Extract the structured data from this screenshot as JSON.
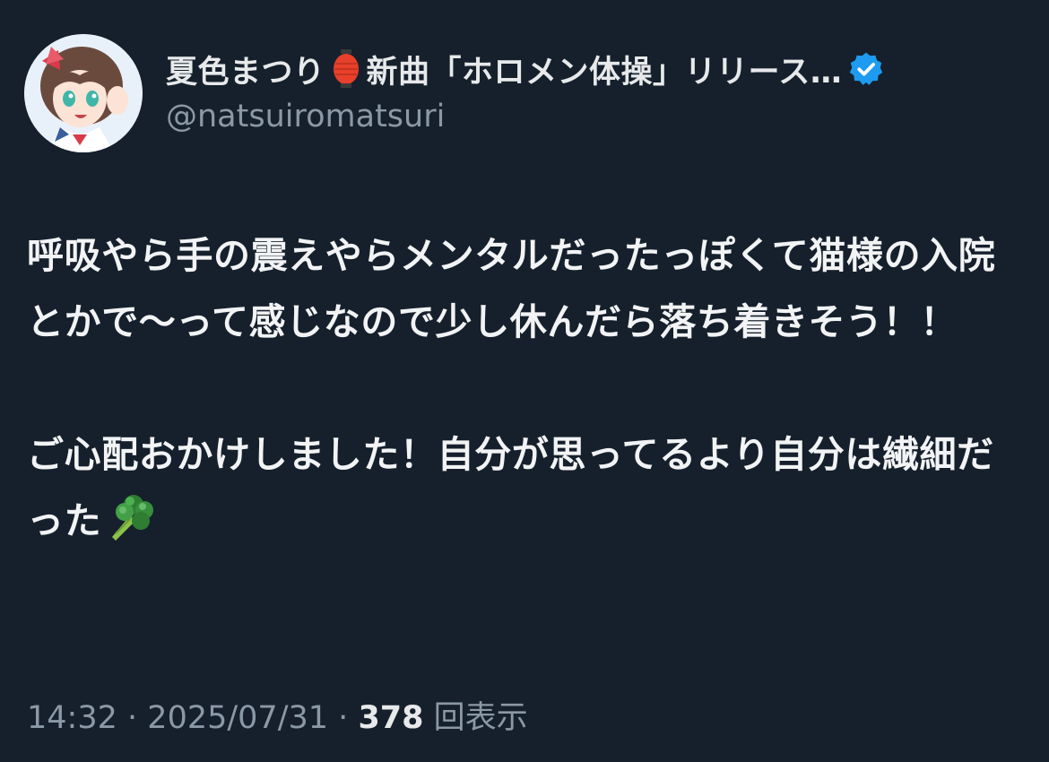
{
  "author": {
    "display_name": "夏色まつり",
    "display_name_suffix": "新曲「ホロメン体操」リリース…",
    "handle": "@natsuiromatsuri",
    "verified": true,
    "icons": [
      "avatar",
      "red-lantern-icon",
      "verified-badge-icon"
    ]
  },
  "tweet": {
    "paragraph1": "呼吸やら手の震えやらメンタルだったっぽくて猫様の入院とかで〜って感じなので少し休んだら落ち着きそう！！",
    "paragraph2": "ご心配おかけしました！自分が思ってるより自分は繊細だった",
    "paragraph2_emoji": "broccoli-icon"
  },
  "meta": {
    "time": "14:32",
    "separator": "·",
    "date": "2025/07/31",
    "views_count": "378",
    "views_label": "回表示"
  },
  "colors": {
    "background": "#16202c",
    "text": "#e7e9ea",
    "secondary": "#8b98a5",
    "verified": "#1d9bf0",
    "lantern": "#e8402a",
    "broccoli": "#4caf50"
  }
}
